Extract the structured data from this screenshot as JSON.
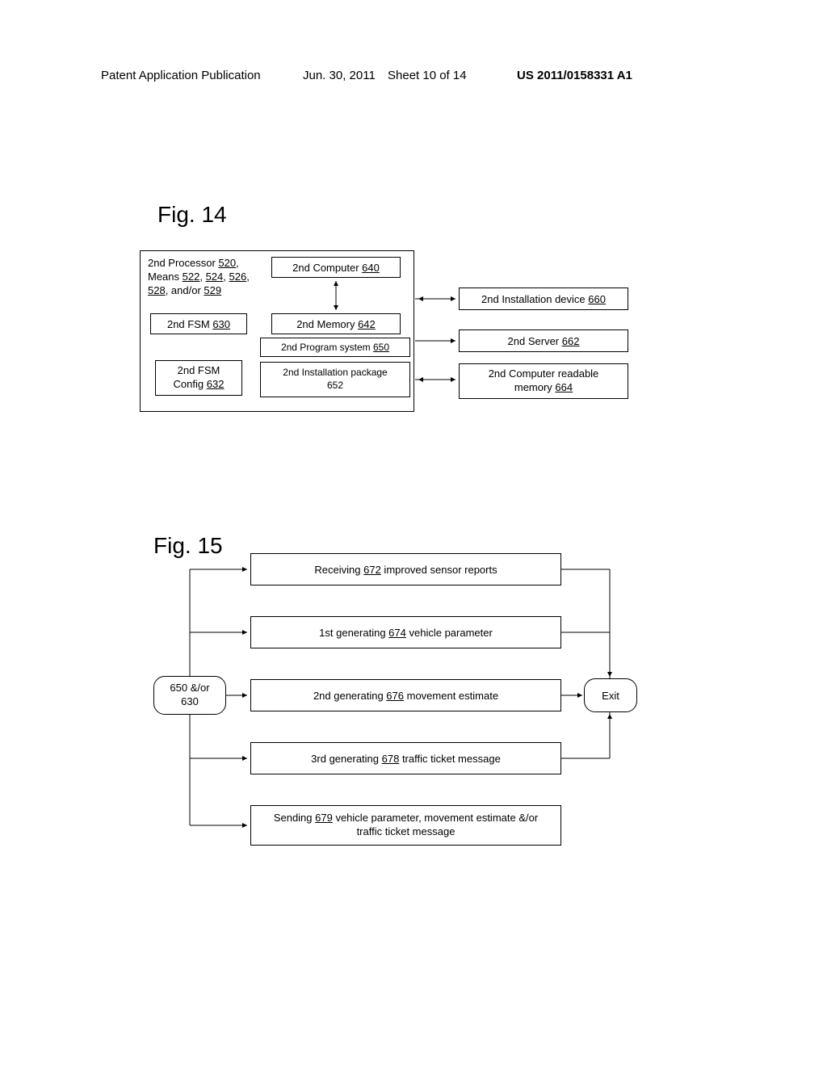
{
  "header": {
    "left": "Patent Application Publication",
    "date": "Jun. 30, 2011",
    "sheet": "Sheet 10 of 14",
    "pubno": "US 2011/0158331 A1"
  },
  "fig14": {
    "title": "Fig. 14",
    "proc": {
      "l1a": "2nd Processor ",
      "l1b": "520",
      "l1c": ",",
      "l2a": "Means ",
      "l2b": "522",
      "l2c": ", ",
      "l2d": "524",
      "l2e": ", ",
      "l2f": "526",
      "l2g": ",",
      "l3a": "528",
      "l3b": ", and/or ",
      "l3c": "529"
    },
    "fsm": {
      "txt": "2nd FSM ",
      "num": "630"
    },
    "fsmcfg": {
      "l1": "2nd FSM",
      "l2a": "Config ",
      "l2b": "632"
    },
    "comp": {
      "txt": "2nd Computer ",
      "num": "640"
    },
    "mem": {
      "txt": "2nd Memory ",
      "num": "642"
    },
    "prog": {
      "txt": "2nd Program system ",
      "num": "650"
    },
    "instpkg": {
      "l1": "2nd Installation package",
      "l2": "652"
    },
    "instdev": {
      "txt": "2nd Installation device ",
      "num": "660"
    },
    "server": {
      "txt": "2nd Server ",
      "num": "662"
    },
    "crm": {
      "l1": "2nd Computer readable",
      "l2a": "memory ",
      "l2b": "664"
    }
  },
  "fig15": {
    "title": "Fig. 15",
    "start": {
      "l1": "650 &/or",
      "l2": "630"
    },
    "exit": "Exit",
    "s1": {
      "a": "Receiving ",
      "n": "672",
      "b": " improved sensor reports"
    },
    "s2": {
      "a": "1st generating ",
      "n": "674",
      "b": " vehicle parameter"
    },
    "s3": {
      "a": "2nd generating ",
      "n": "676",
      "b": " movement estimate"
    },
    "s4": {
      "a": "3rd generating ",
      "n": "678",
      "b": " traffic ticket message"
    },
    "s5": {
      "a": "Sending ",
      "n": "679",
      "b": " vehicle parameter, movement estimate &/or",
      "c": "traffic ticket message"
    }
  }
}
